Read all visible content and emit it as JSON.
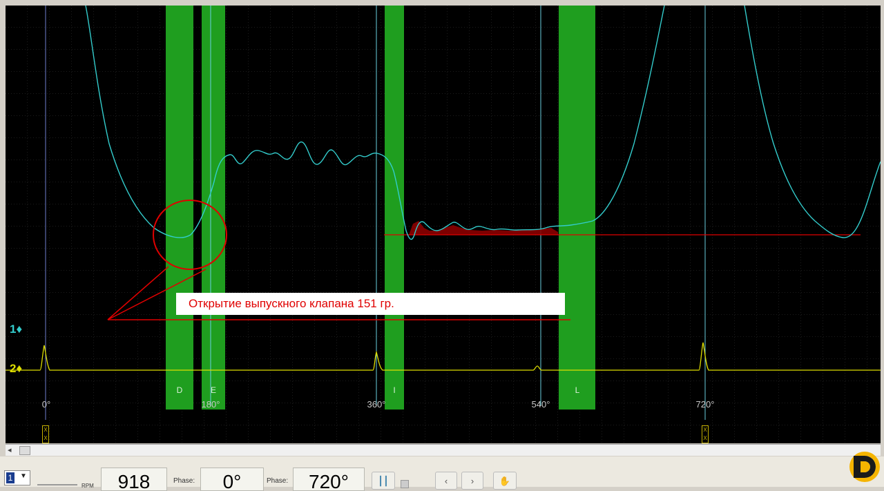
{
  "channels": [
    {
      "label": "1♦",
      "color": "#33cccc"
    },
    {
      "label": "2♦",
      "color": "#dddd00"
    }
  ],
  "degree_marks": [
    "0°",
    "180°",
    "360°",
    "540°",
    "720°"
  ],
  "zones": [
    "D",
    "E",
    "I",
    "L"
  ],
  "annotation": "Открытие выпускного клапана 151 гр.",
  "colors": {
    "background": "#000000",
    "trace_pressure": "#33cccc",
    "trace_sync": "#dddd00",
    "valve_zone": "#1f9e1f",
    "annotation": "#e00000",
    "cursor": "#6ad0e0"
  },
  "toolbar": {
    "channel_select_value": "1",
    "rpm_label": "RPM",
    "rpm_value": "918",
    "phase1_label": "Phase:",
    "phase1_value": "0°",
    "phase2_label": "Phase:",
    "phase2_value": "720°",
    "prev_label": "‹",
    "next_label": "›"
  },
  "icons": [
    "dropdown-arrow-icon",
    "cursor-tool-icon",
    "hand-tool-icon",
    "logo-icon"
  ]
}
